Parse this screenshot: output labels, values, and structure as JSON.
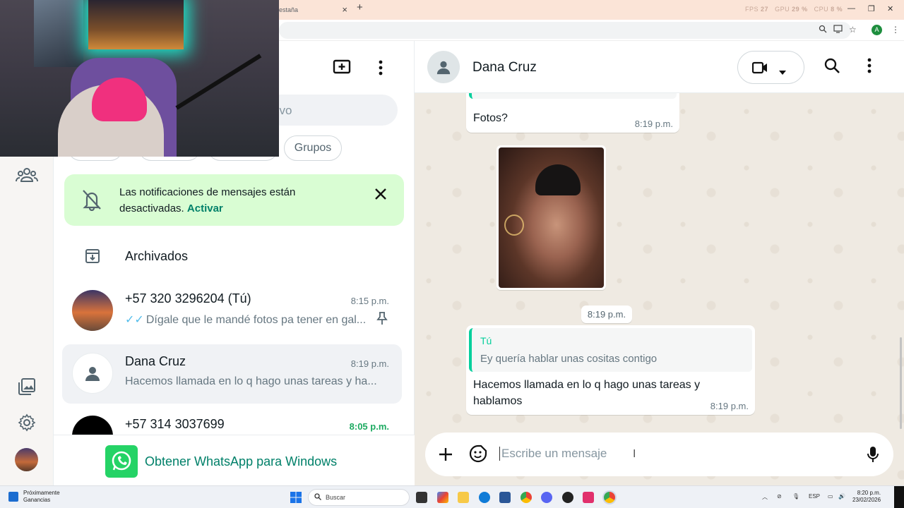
{
  "browser": {
    "tab_title": "estaña",
    "stats": {
      "fps_label": "FPS",
      "fps": "27",
      "gpu_label": "GPU",
      "gpu": "29 %",
      "cpu_label": "CPU",
      "cpu": "8 %"
    },
    "profile_initial": "A"
  },
  "left_panel": {
    "search_placeholder": "evo",
    "chip_groups": "Grupos",
    "notice": {
      "text": "Las notificaciones de mensajes están desactivadas.",
      "action": "Activar"
    },
    "archived_label": "Archivados",
    "chats": [
      {
        "name": "+57 320 3296204 (Tú)",
        "time": "8:15 p.m.",
        "preview": "Dígale que le mandé fotos pa tener en gal...",
        "pinned": true,
        "read_ticks": "✓✓"
      },
      {
        "name": "Dana Cruz",
        "time": "8:19 p.m.",
        "preview": "Hacemos llamada en lo q hago unas tareas y ha..."
      },
      {
        "name": "+57 314 3037699",
        "time": "8:05 p.m.",
        "unread": true
      }
    ],
    "promo": "Obtener WhatsApp para Windows"
  },
  "conversation": {
    "contact_name": "Dana Cruz",
    "messages": [
      {
        "text": "Fotos?",
        "time": "8:19 p.m."
      },
      {
        "type": "image",
        "time_chip": "8:19 p.m."
      },
      {
        "quote_author": "Tú",
        "quote_text": "Ey quería hablar unas cositas contigo",
        "text": "Hacemos llamada en lo q hago unas tareas y hablamos",
        "time": "8:19 p.m."
      }
    ],
    "composer_placeholder": "Escribe un mensaje"
  },
  "taskbar": {
    "news_title": "Próximamente",
    "news_sub": "Ganancias",
    "search_label": "Buscar",
    "lang": "ESP",
    "time": "8:20 p.m.",
    "date": "23/02/2026"
  },
  "colors": {
    "accent": "#008069",
    "bubble_green": "#d9fdd3",
    "chat_bg": "#efeae2",
    "unread": "#1daa61"
  }
}
